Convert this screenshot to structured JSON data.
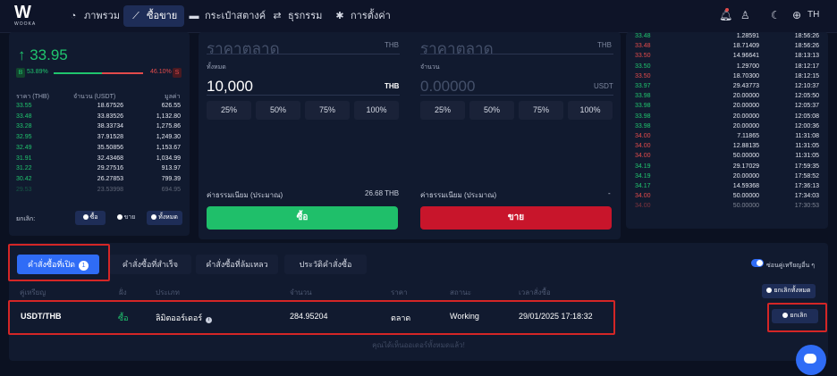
{
  "nav": {
    "logo_text": "W",
    "logo_sub": "WOOKA",
    "items": [
      {
        "label": "ภาพรวม",
        "icon": "pie-chart-icon"
      },
      {
        "label": "ซื้อขาย",
        "icon": "chart-line-icon"
      },
      {
        "label": "กระเป๋าสตางค์",
        "icon": "wallet-icon"
      },
      {
        "label": "ธุรกรรม",
        "icon": "transfer-icon"
      },
      {
        "label": "การตั้งค่า",
        "icon": "gear-icon"
      }
    ],
    "lang": "TH"
  },
  "orderbook": {
    "last_price": "↑ 33.95",
    "buy_badge": "B",
    "buy_pct": "53.89%",
    "sell_pct": "46.10%",
    "sell_badge": "S",
    "buy_fraction": 0.5389,
    "headers": {
      "price": "ราคา (THB)",
      "amount": "จำนวน (USDT)",
      "value": "มูลค่า"
    },
    "rows": [
      {
        "price": "33.55",
        "amount": "18.67526",
        "value": "626.55"
      },
      {
        "price": "33.48",
        "amount": "33.83526",
        "value": "1,132.80"
      },
      {
        "price": "33.28",
        "amount": "38.33734",
        "value": "1,275.86"
      },
      {
        "price": "32.95",
        "amount": "37.91528",
        "value": "1,249.30"
      },
      {
        "price": "32.49",
        "amount": "35.50856",
        "value": "1,153.67"
      },
      {
        "price": "31.91",
        "amount": "32.43468",
        "value": "1,034.99"
      },
      {
        "price": "31.22",
        "amount": "29.27516",
        "value": "913.97"
      },
      {
        "price": "30.42",
        "amount": "26.27853",
        "value": "799.39"
      },
      {
        "price": "29.53",
        "amount": "23.53998",
        "value": "694.95"
      }
    ],
    "cancel_label": "ยกเลิก:",
    "cancel_buttons": [
      "ซื้อ",
      "ขาย",
      "ทั้งหมด"
    ]
  },
  "buy_form": {
    "price_placeholder": "ราคาตลาด",
    "price_unit": "THB",
    "amount_label": "ทั้งหมด",
    "amount_value": "10,000",
    "amount_unit": "THB",
    "percents": [
      "25%",
      "50%",
      "75%",
      "100%"
    ],
    "fee_label": "ค่าธรรมเนียม (ประมาณ)",
    "fee_value": "26.68 THB",
    "submit_label": "ซื้อ"
  },
  "sell_form": {
    "price_placeholder": "ราคาตลาด",
    "price_unit": "THB",
    "amount_label": "จำนวน",
    "amount_value": "0.00000",
    "amount_unit": "USDT",
    "percents": [
      "25%",
      "50%",
      "75%",
      "100%"
    ],
    "fee_label": "ค่าธรรมเนียม (ประมาณ)",
    "fee_value": "-",
    "submit_label": "ขาย"
  },
  "trades": [
    {
      "price": "33.48",
      "amount": "1.28591",
      "time": "18:56:26",
      "side": "buy"
    },
    {
      "price": "33.48",
      "amount": "18.71409",
      "time": "18:56:26",
      "side": "sell"
    },
    {
      "price": "33.50",
      "amount": "14.96641",
      "time": "18:13:13",
      "side": "sell"
    },
    {
      "price": "33.50",
      "amount": "1.29700",
      "time": "18:12:17",
      "side": "buy"
    },
    {
      "price": "33.50",
      "amount": "18.70300",
      "time": "18:12:15",
      "side": "sell"
    },
    {
      "price": "33.97",
      "amount": "29.43773",
      "time": "12:10:37",
      "side": "buy"
    },
    {
      "price": "33.98",
      "amount": "20.00000",
      "time": "12:05:50",
      "side": "buy"
    },
    {
      "price": "33.98",
      "amount": "20.00000",
      "time": "12:05:37",
      "side": "buy"
    },
    {
      "price": "33.98",
      "amount": "20.00000",
      "time": "12:05:08",
      "side": "buy"
    },
    {
      "price": "33.98",
      "amount": "20.00000",
      "time": "12:00:36",
      "side": "buy"
    },
    {
      "price": "34.00",
      "amount": "7.11865",
      "time": "11:31:08",
      "side": "sell"
    },
    {
      "price": "34.00",
      "amount": "12.88135",
      "time": "11:31:05",
      "side": "sell"
    },
    {
      "price": "34.00",
      "amount": "50.00000",
      "time": "11:31:05",
      "side": "sell"
    },
    {
      "price": "34.19",
      "amount": "29.17029",
      "time": "17:59:35",
      "side": "buy"
    },
    {
      "price": "34.19",
      "amount": "20.00000",
      "time": "17:58:52",
      "side": "buy"
    },
    {
      "price": "34.17",
      "amount": "14.59368",
      "time": "17:36:13",
      "side": "buy"
    },
    {
      "price": "34.00",
      "amount": "50.00000",
      "time": "17:34:03",
      "side": "sell"
    },
    {
      "price": "34.00",
      "amount": "50.00000",
      "time": "17:30:53",
      "side": "sell"
    }
  ],
  "orders": {
    "tabs": [
      {
        "label": "คำสั่งซื้อที่เปิด",
        "count": "1"
      },
      {
        "label": "คำสั่งซื้อที่สำเร็จ"
      },
      {
        "label": "คำสั่งซื้อที่ล้มเหลว"
      },
      {
        "label": "ประวัติคำสั่งซื้อ"
      }
    ],
    "hide_pairs_label": "ซ่อนคู่เหรียญอื่น ๆ",
    "cancel_all_label": "ยกเลิกทั้งหมด",
    "headers": [
      "คู่เหรียญ",
      "ฝั่ง",
      "ประเภท",
      "จำนวน",
      "ราคา",
      "สถานะ",
      "เวลาสั่งซื้อ"
    ],
    "row": {
      "pair": "USDT/THB",
      "side": "ซื้อ",
      "type": "ลิมิตออร์เดอร์",
      "amount": "284.95204",
      "price": "ตลาด",
      "status": "Working",
      "time": "29/01/2025 17:18:32",
      "cancel_label": "ยกเลิก"
    },
    "empty_message": "คุณได้เห็นออเดอร์ทั้งหมดแล้ว!"
  },
  "colors": {
    "buy": "#20c56e",
    "sell": "#e34b4b",
    "accent": "#2f6cf6",
    "highlight_box": "#d42626"
  }
}
